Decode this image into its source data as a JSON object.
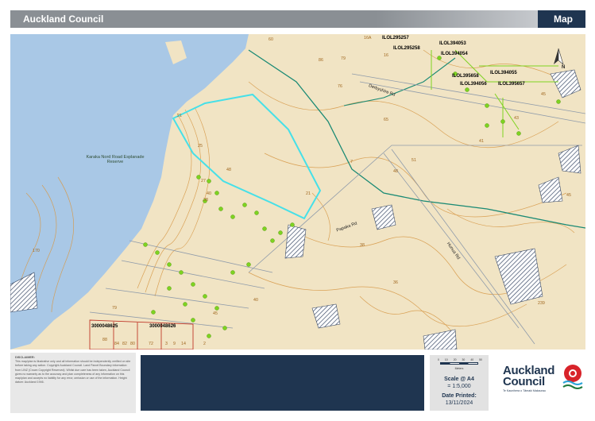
{
  "header": {
    "title": "Auckland Council",
    "section": "Map"
  },
  "map": {
    "place_labels": [
      {
        "id": "reserve",
        "text": "Karaka Nord Road Esplanade Reserve"
      },
      {
        "id": "road-derbyshire",
        "text": "Derbyshire Rd"
      },
      {
        "id": "road-hunua",
        "text": "Hunua Rd"
      },
      {
        "id": "road-papaka",
        "text": "Papaka Rd"
      }
    ],
    "parcel_ids": [
      "ILOL295257",
      "ILOL394053",
      "ILOL295258",
      "ILOL394054",
      "ILOL395658",
      "ILOL394055",
      "ILOL394056",
      "ILOL395657",
      "3000048625",
      "3000048626"
    ],
    "address_numbers": [
      "16A",
      "60",
      "86",
      "79",
      "76",
      "45",
      "16",
      "65",
      "43",
      "41",
      "21",
      "25",
      "27",
      "7",
      "48",
      "51",
      "21",
      "170",
      "38",
      "36",
      "40",
      "239",
      "48",
      "40",
      "38",
      "45",
      "45",
      "79",
      "88",
      "84",
      "82",
      "80",
      "72",
      "3",
      "9",
      "14",
      "2"
    ],
    "north_label": "N",
    "colors": {
      "water": "#a9c8e6",
      "land": "#f1e4c4",
      "contour": "#d79a4a",
      "boundary": "#1a8a74",
      "selected": "#46e0e8",
      "green_marker": "#7ed321",
      "hatch": "#3a4a66"
    }
  },
  "footer": {
    "disclaimer_title": "DISCLAIMER:",
    "disclaimer_text": "This map/plan is illustrative only and all information should be independently verified on site before taking any action. Copyright Auckland Council. Land Parcel Boundary information from LINZ (Crown Copyright Reserved). Whilst due care has been taken, Auckland Council gives no warranty as to the accuracy and plan completeness of any information on this map/plan and accepts no liability for any error, omission or use of the information. Height datum: Auckland 1946.",
    "scale": {
      "ticks": [
        "0",
        "10",
        "20",
        "30",
        "40",
        "50"
      ],
      "unit": "Meters",
      "label": "Scale @ A4",
      "value": "= 1:5,000"
    },
    "date": {
      "label": "Date Printed:",
      "value": "13/11/2024"
    },
    "logo": {
      "line1": "Auckland",
      "line2": "Council",
      "sub": "Te Kaunihera o Tāmaki Makaurau"
    }
  }
}
